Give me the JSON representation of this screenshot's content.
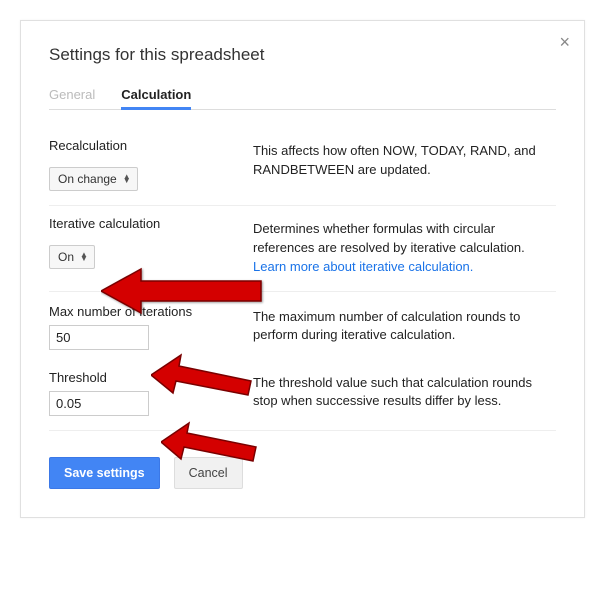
{
  "dialog": {
    "title": "Settings for this spreadsheet",
    "tabs": {
      "general": "General",
      "calculation": "Calculation"
    }
  },
  "recalc": {
    "label": "Recalculation",
    "value": "On change",
    "help": "This affects how often NOW, TODAY, RAND, and RANDBETWEEN are updated."
  },
  "iter": {
    "label": "Iterative calculation",
    "value": "On",
    "help": "Determines whether formulas with circular references are resolved by iterative calculation.",
    "learn_more": "Learn more about iterative calculation."
  },
  "max_iter": {
    "label": "Max number of iterations",
    "value": "50",
    "help": "The maximum number of calculation rounds to perform during iterative calculation."
  },
  "threshold": {
    "label": "Threshold",
    "value": "0.05",
    "help": "The threshold value such that calculation rounds stop when successive results differ by less."
  },
  "buttons": {
    "save": "Save settings",
    "cancel": "Cancel"
  }
}
